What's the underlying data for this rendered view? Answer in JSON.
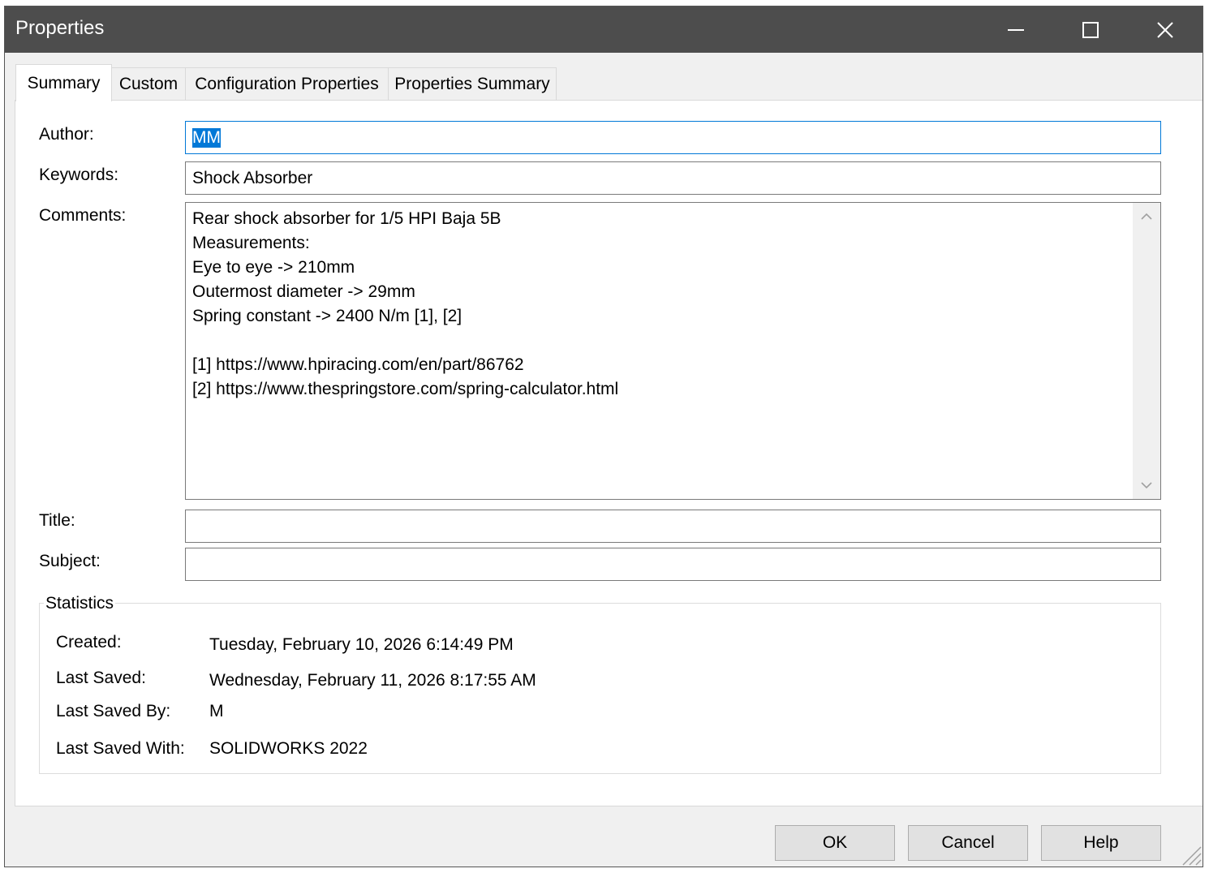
{
  "window": {
    "title": "Properties",
    "controls": {
      "minimize": "minimize-icon",
      "maximize": "maximize-icon",
      "close": "close-icon"
    }
  },
  "tabs": [
    {
      "label": "Summary",
      "active": true
    },
    {
      "label": "Custom",
      "active": false
    },
    {
      "label": "Configuration Properties",
      "active": false
    },
    {
      "label": "Properties Summary",
      "active": false
    }
  ],
  "summary": {
    "author": {
      "label": "Author:",
      "value": "MM",
      "selected": true
    },
    "keywords": {
      "label": "Keywords:",
      "value": "Shock Absorber"
    },
    "comments": {
      "label": "Comments:",
      "value": "Rear shock absorber for 1/5 HPI Baja 5B\nMeasurements:\nEye to eye -> 210mm\nOutermost diameter -> 29mm\nSpring constant -> 2400 N/m [1], [2]\n\n[1] https://www.hpiracing.com/en/part/86762\n[2] https://www.thespringstore.com/spring-calculator.html"
    },
    "title": {
      "label": "Title:",
      "value": ""
    },
    "subject": {
      "label": "Subject:",
      "value": ""
    }
  },
  "statistics": {
    "group_title": "Statistics",
    "created": {
      "label": "Created:",
      "value": "Tuesday, February 10, 2026 6:14:49 PM"
    },
    "last_saved": {
      "label": "Last Saved:",
      "value": "Wednesday, February 11, 2026 8:17:55 AM"
    },
    "last_saved_by": {
      "label": "Last Saved By:",
      "value": "M"
    },
    "last_saved_with": {
      "label": "Last Saved With:",
      "value": "SOLIDWORKS 2022"
    }
  },
  "buttons": {
    "ok": "OK",
    "cancel": "Cancel",
    "help": "Help"
  },
  "colors": {
    "titlebar": "#4d4d4d",
    "selection": "#0078d7",
    "dialog_bg": "#f0f0f0"
  }
}
